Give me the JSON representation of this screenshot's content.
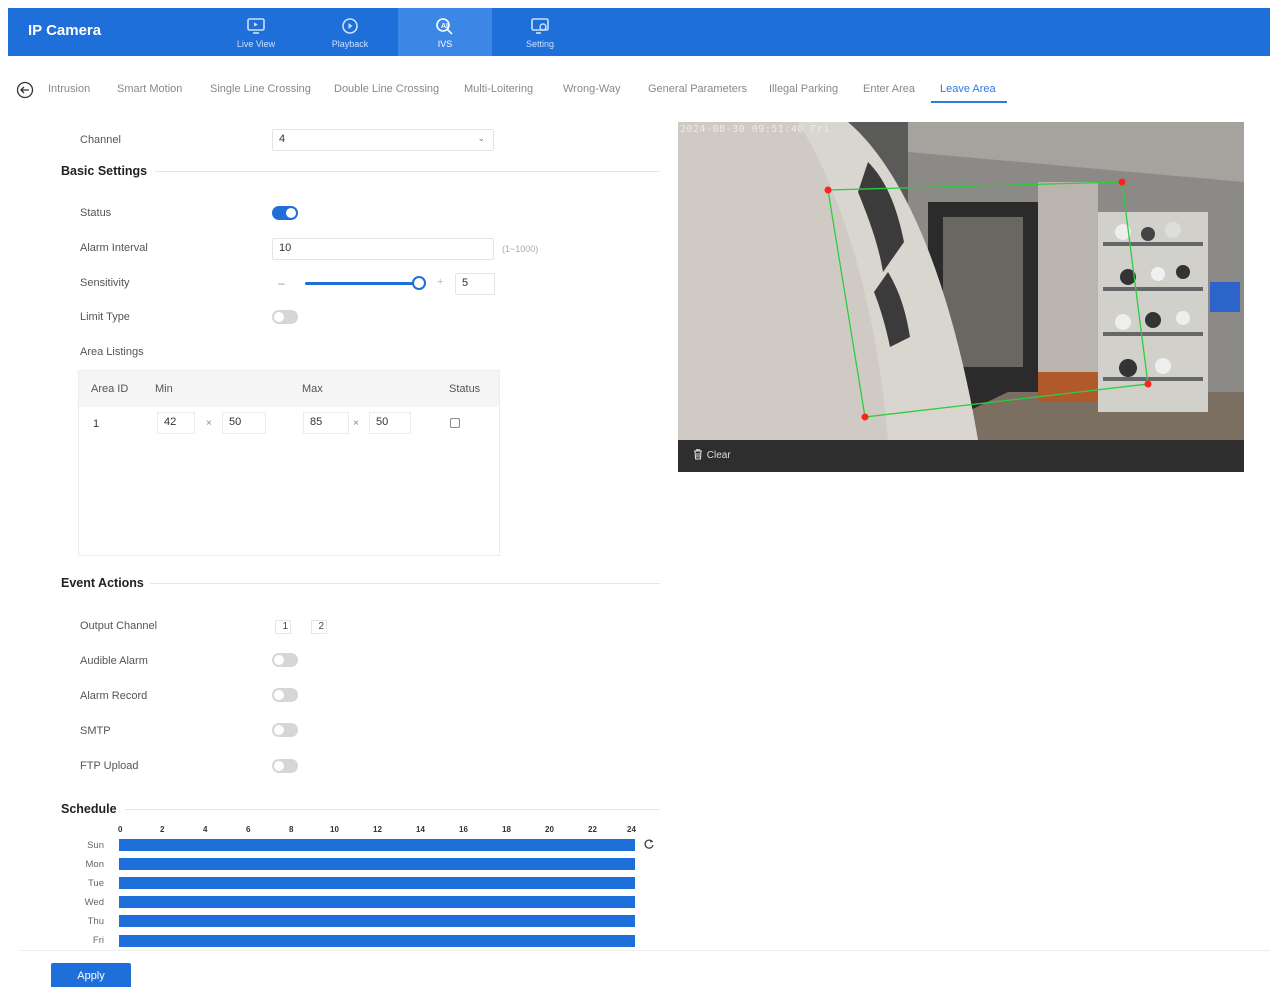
{
  "header": {
    "brand": "IP Camera",
    "nav": [
      {
        "label": "Live View",
        "icon": "monitor-icon"
      },
      {
        "label": "Playback",
        "icon": "play-circle-icon"
      },
      {
        "label": "IVS",
        "icon": "ai-icon",
        "active": true
      },
      {
        "label": "Setting",
        "icon": "settings-screen-icon"
      }
    ]
  },
  "tabs": [
    "Intrusion",
    "Smart Motion",
    "Single Line Crossing",
    "Double Line Crossing",
    "Multi-Loitering",
    "Wrong-Way",
    "General Parameters",
    "Illegal Parking",
    "Enter Area",
    "Leave Area"
  ],
  "active_tab": "Leave Area",
  "form": {
    "channel_label": "Channel",
    "channel_value": "4",
    "basic_settings": "Basic Settings",
    "status_label": "Status",
    "status_on": true,
    "alarm_interval_label": "Alarm Interval",
    "alarm_interval_value": "10",
    "alarm_interval_hint": "(1~1000)",
    "sensitivity_label": "Sensitivity",
    "sensitivity_value": "5",
    "limit_type_label": "Limit Type",
    "limit_type_on": false,
    "area_listings_label": "Area Listings",
    "area_table": {
      "headers": [
        "Area ID",
        "Min",
        "Max",
        "Status"
      ],
      "rows": [
        {
          "id": "1",
          "min_w": "42",
          "min_h": "50",
          "max_w": "85",
          "max_h": "50",
          "checked": false
        }
      ],
      "times": "×"
    }
  },
  "event_actions": {
    "title": "Event Actions",
    "output_channel_label": "Output Channel",
    "output_channels": [
      "1",
      "2"
    ],
    "audible_alarm_label": "Audible Alarm",
    "alarm_record_label": "Alarm Record",
    "smtp_label": "SMTP",
    "ftp_label": "FTP Upload"
  },
  "schedule": {
    "title": "Schedule",
    "hours": [
      "0",
      "2",
      "4",
      "6",
      "8",
      "10",
      "12",
      "14",
      "16",
      "18",
      "20",
      "22",
      "24"
    ],
    "days": [
      "Sun",
      "Mon",
      "Tue",
      "Wed",
      "Thu",
      "Fri"
    ]
  },
  "video": {
    "timestamp": "2024-08-30 09:51:40 Fri",
    "clear_label": "Clear"
  },
  "apply_label": "Apply",
  "colors": {
    "accent": "#1e6fd9",
    "header": "#1e6fd9",
    "region": "#2ecc40",
    "marker": "#ff2222"
  }
}
